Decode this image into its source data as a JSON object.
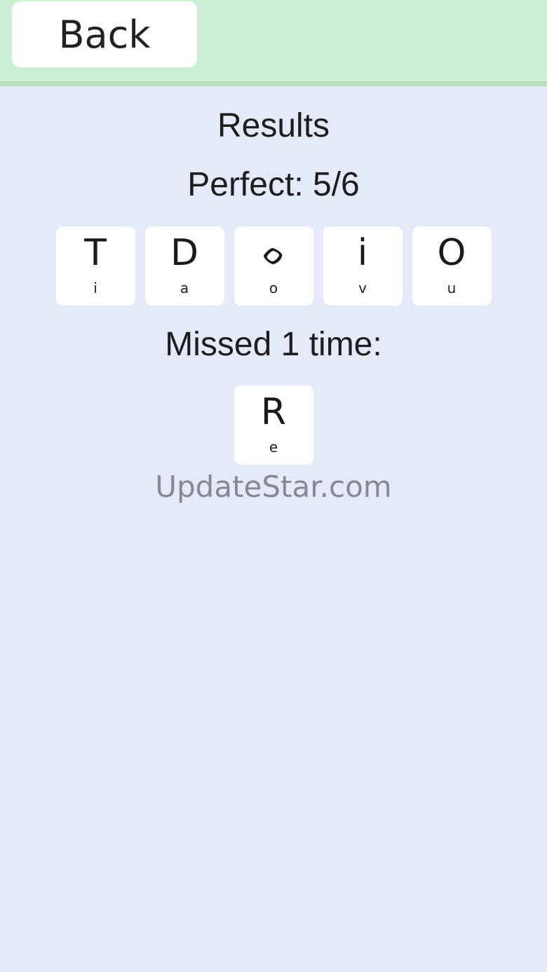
{
  "header": {
    "back_label": "Back"
  },
  "results": {
    "title": "Results",
    "perfect_label": "Perfect: 5/6",
    "perfect_tiles": [
      {
        "glyph": "T",
        "sub": "i"
      },
      {
        "glyph": "D",
        "sub": "a"
      },
      {
        "glyph": "ᨔ",
        "sub": "o"
      },
      {
        "glyph": "i",
        "sub": "v"
      },
      {
        "glyph": "O",
        "sub": "u"
      }
    ],
    "missed_label": "Missed 1 time:",
    "missed_tiles": [
      {
        "glyph": "R",
        "sub": "e"
      }
    ]
  },
  "watermark": "UpdateStar.com",
  "colors": {
    "header_bg": "#cdf0d4",
    "page_bg": "#e4eaf9",
    "tile_bg": "#ffffff"
  }
}
